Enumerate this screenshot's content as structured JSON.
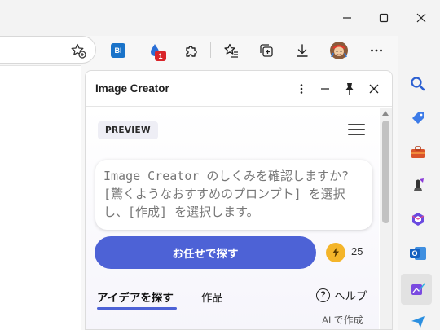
{
  "colors": {
    "accent": "#4d62d6",
    "bolt": "#f4b52a",
    "notification": "#d9252a"
  },
  "window_controls": {
    "minimize_icon": "minimize-icon",
    "maximize_icon": "maximize-icon",
    "close_icon": "close-icon"
  },
  "toolbar": {
    "icons": [
      "add-favorite-icon",
      "bi-extension-icon",
      "extension-icon",
      "extensions-puzzle-icon",
      "favorites-icon",
      "collections-icon",
      "downloads-icon",
      "profile-avatar-icon",
      "more-icon",
      "copilot-icon"
    ],
    "bi_label": "BI",
    "notification_count": "1"
  },
  "sidebar": {
    "icons": [
      "search-icon",
      "shopping-tag-icon",
      "tools-icon",
      "games-chess-icon",
      "microsoft365-icon",
      "outlook-icon",
      "image-creator-icon",
      "send-icon"
    ],
    "outlook_letter": "O"
  },
  "pane": {
    "title": "Image Creator",
    "more_icon": "more-vertical-icon",
    "minimize_icon": "minimize-icon",
    "pin_icon": "pin-icon",
    "close_icon": "close-icon"
  },
  "image_creator": {
    "badge": "PREVIEW",
    "menu_icon": "hamburger-menu-icon",
    "prompt_placeholder": "Image Creator のしくみを確認しますか? [驚くようなおすすめのプロンプト] を選択し、[作成] を選択します。",
    "surprise_button": "お任せで探す",
    "boost_icon": "lightning-bolt-icon",
    "boost_count": "25",
    "tabs": [
      {
        "label": "アイデアを探す",
        "active": true
      },
      {
        "label": "作品",
        "active": false
      }
    ],
    "help_label": "ヘルプ",
    "help_symbol": "?",
    "ai_made": "AI で作成"
  }
}
